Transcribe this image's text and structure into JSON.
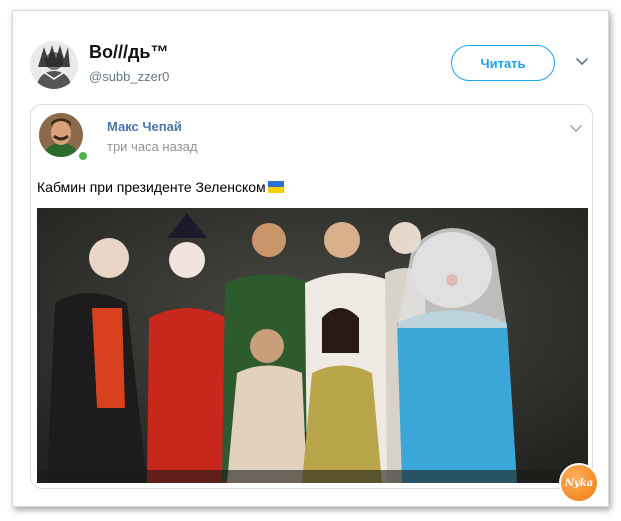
{
  "tweet": {
    "user_name": "Во///дь™",
    "user_handle": "@subb_zzer0",
    "follow_label": "Читать"
  },
  "quoted": {
    "author": "Макс Чепай",
    "time": "три часа назад",
    "text": "Кабмин при президенте Зеленском"
  },
  "watermark": {
    "text": "Nyka"
  },
  "colors": {
    "accent": "#1da1f2",
    "vk_link": "#4a76a8",
    "online": "#4bb34b",
    "flag_blue": "#2f6fd6",
    "flag_yellow": "#f7d000"
  },
  "icons": [
    "chevron-down-icon",
    "ukraine-flag-icon"
  ]
}
